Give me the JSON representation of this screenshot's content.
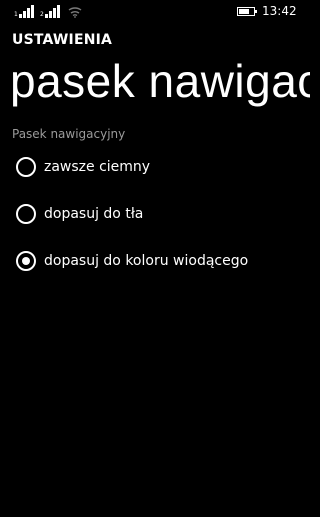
{
  "status_bar": {
    "time": "13:42",
    "sim1_label": "1",
    "sim2_label": "2",
    "battery_level": 0.8,
    "icons": [
      "signal-sim1-icon",
      "signal-sim2-icon",
      "wifi-icon",
      "battery-icon"
    ]
  },
  "header": {
    "app_title": "USTAWIENIA",
    "page_title": "pasek nawigacyjny"
  },
  "settings": {
    "section_label": "Pasek nawigacyjny",
    "options": [
      {
        "label": "zawsze ciemny",
        "selected": false
      },
      {
        "label": "dopasuj do tła",
        "selected": false
      },
      {
        "label": "dopasuj do koloru wiodącego",
        "selected": true
      }
    ]
  },
  "colors": {
    "background": "#000000",
    "foreground": "#ffffff",
    "secondary_text": "#9a9a9a"
  }
}
